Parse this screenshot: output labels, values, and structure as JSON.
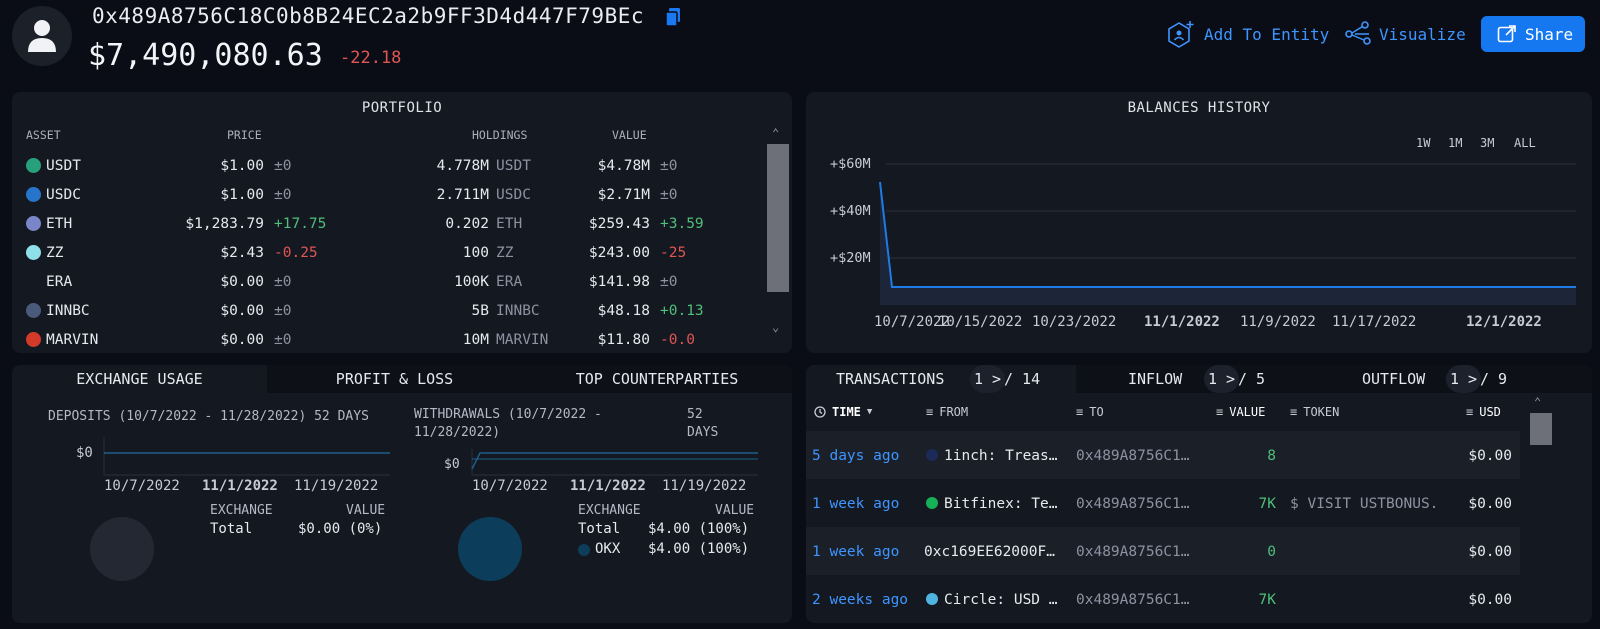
{
  "header": {
    "address": "0x489A8756C18C0b8B24EC2a2b9FF3D4d447F79BEc",
    "total_value": "$7,490,080.63",
    "value_change": "-22.18",
    "add_entity_label": "Add To Entity",
    "visualize_label": "Visualize",
    "share_label": "Share"
  },
  "portfolio": {
    "title": "PORTFOLIO",
    "columns": [
      "ASSET",
      "PRICE",
      "HOLDINGS",
      "VALUE"
    ],
    "rows": [
      {
        "asset": "USDT",
        "icon": "usdt-icon",
        "price": "$1.00",
        "price_change": "±0",
        "holdings": "4.778M",
        "holdings_unit": "USDT",
        "value": "$4.78M",
        "value_change": "±0"
      },
      {
        "asset": "USDC",
        "icon": "usdc-icon",
        "price": "$1.00",
        "price_change": "±0",
        "holdings": "2.711M",
        "holdings_unit": "USDC",
        "value": "$2.71M",
        "value_change": "±0"
      },
      {
        "asset": "ETH",
        "icon": "eth-icon",
        "price": "$1,283.79",
        "price_change": "+17.75",
        "holdings": "0.202",
        "holdings_unit": "ETH",
        "value": "$259.43",
        "value_change": "+3.59"
      },
      {
        "asset": "ZZ",
        "icon": "zz-icon",
        "price": "$2.43",
        "price_change": "-0.25",
        "holdings": "100",
        "holdings_unit": "ZZ",
        "value": "$243.00",
        "value_change": "-25"
      },
      {
        "asset": "ERA",
        "icon": "",
        "price": "$0.00",
        "price_change": "±0",
        "holdings": "100K",
        "holdings_unit": "ERA",
        "value": "$141.98",
        "value_change": "±0"
      },
      {
        "asset": "INNBC",
        "icon": "innbc-icon",
        "price": "$0.00",
        "price_change": "±0",
        "holdings": "5B",
        "holdings_unit": "INNBC",
        "value": "$48.18",
        "value_change": "+0.13"
      },
      {
        "asset": "MARVIN",
        "icon": "marvin-icon",
        "price": "$0.00",
        "price_change": "±0",
        "holdings": "10M",
        "holdings_unit": "MARVIN",
        "value": "$11.80",
        "value_change": "-0.0"
      }
    ]
  },
  "balances": {
    "title": "BALANCES HISTORY",
    "ranges": [
      "1W",
      "1M",
      "3M",
      "ALL"
    ],
    "y_ticks": [
      "+$60M",
      "+$40M",
      "+$20M"
    ],
    "x_ticks": [
      "10/7/2022",
      "10/15/2022",
      "10/23/2022",
      "11/1/2022",
      "11/9/2022",
      "11/17/2022",
      "12/1/2022"
    ],
    "line_color": "#1e7be6"
  },
  "exchange": {
    "tabs": [
      "EXCHANGE USAGE",
      "PROFIT & LOSS",
      "TOP COUNTERPARTIES"
    ],
    "deposits": {
      "label": "DEPOSITS (10/7/2022 - 11/28/2022) 52 DAYS",
      "y_tick": "$0",
      "x_ticks": [
        "10/7/2022",
        "11/1/2022",
        "11/19/2022"
      ],
      "col_exchange": "EXCHANGE",
      "col_value": "VALUE",
      "total_label": "Total",
      "total_value": "$0.00 (0%)"
    },
    "withdrawals": {
      "label_line1": "WITHDRAWALS (10/7/2022 -",
      "label_line2": "11/28/2022)",
      "days_line1": "52",
      "days_line2": "DAYS",
      "y_tick": "$0",
      "x_ticks": [
        "10/7/2022",
        "11/1/2022",
        "11/19/2022"
      ],
      "col_exchange": "EXCHANGE",
      "col_value": "VALUE",
      "total_label": "Total",
      "total_value": "$4.00 (100%)",
      "okx_label": "OKX",
      "okx_value": "$4.00 (100%)"
    }
  },
  "transactions": {
    "tabs": [
      {
        "label": "TRANSACTIONS",
        "page": "1",
        "pages": "/ 14"
      },
      {
        "label": "INFLOW",
        "page": "1",
        "pages": "/ 5"
      },
      {
        "label": "OUTFLOW",
        "page": "1",
        "pages": "/ 9"
      }
    ],
    "columns": [
      "TIME",
      "FROM",
      "TO",
      "VALUE",
      "TOKEN",
      "USD"
    ],
    "rows": [
      {
        "time": "5 days ago",
        "from": "1inch: Treas…",
        "to": "0x489A8756C1…",
        "value": "8",
        "token": "",
        "usd": "$0.00"
      },
      {
        "time": "1 week ago",
        "from": "Bitfinex: Te…",
        "to": "0x489A8756C1…",
        "value": "7K",
        "token": "$ VISIT USTBONUS.",
        "usd": "$0.00"
      },
      {
        "time": "1 week ago",
        "from": "0xc169EE62000F…",
        "to": "0x489A8756C1…",
        "value": "0",
        "token": "",
        "usd": "$0.00"
      },
      {
        "time": "2 weeks ago",
        "from": "Circle: USD …",
        "to": "0x489A8756C1…",
        "value": "7K",
        "token": "",
        "usd": "$0.00"
      }
    ]
  }
}
